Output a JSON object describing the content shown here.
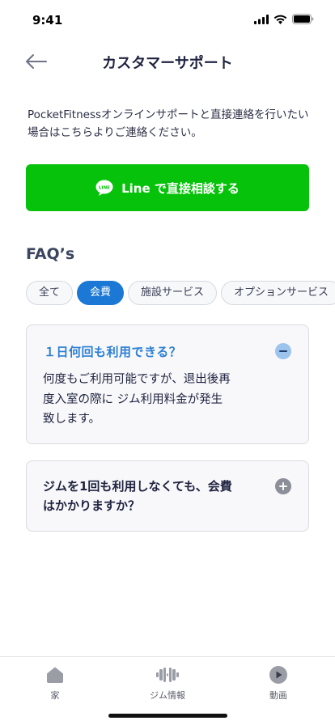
{
  "status_bar": {
    "time": "9:41"
  },
  "header": {
    "title": "カスタマーサポート"
  },
  "intro": {
    "text": "PocketFitnessオンラインサポートと直接連絡を行いたい 場合はこちらよりご連絡ください。"
  },
  "line_button": {
    "label": "Line で直接相談する",
    "icon_text": "LINE"
  },
  "faq": {
    "heading": "FAQ’s",
    "categories": [
      {
        "label": "全て",
        "active": false
      },
      {
        "label": "会費",
        "active": true
      },
      {
        "label": "施設サービス",
        "active": false
      },
      {
        "label": "オプションサービス",
        "active": false
      }
    ],
    "items": [
      {
        "question": "１日何回も利用できる？",
        "answer_lines": [
          "何度もご利用可能ですが、退出後再",
          "度入室の際に ジム利用料金が発生",
          "致します。"
        ],
        "expanded": true
      },
      {
        "question_lines": [
          "ジムを1回も利用しなくても、会費",
          "はかかりますか？"
        ],
        "expanded": false
      }
    ]
  },
  "tab_bar": {
    "items": [
      {
        "label": "家",
        "icon": "home-icon"
      },
      {
        "label": "ジム情報",
        "icon": "dumbbell-icon"
      },
      {
        "label": "動画",
        "icon": "video-play-icon"
      }
    ]
  },
  "colors": {
    "line_green": "#06c20a",
    "accent_blue": "#1b78d4",
    "title_text": "#1f2340"
  }
}
